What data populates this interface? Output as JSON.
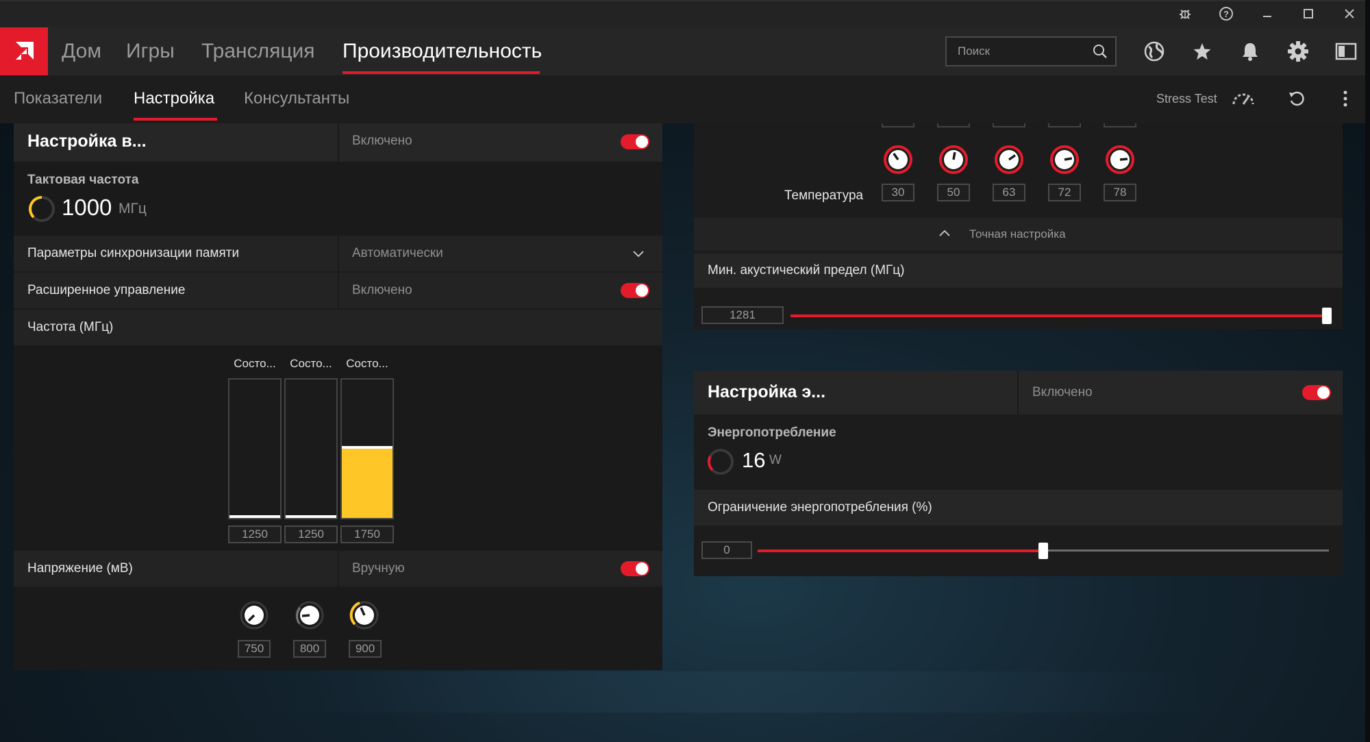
{
  "window": {
    "controls": [
      "bug-icon",
      "help-icon",
      "minimize-icon",
      "maximize-icon",
      "close-icon"
    ]
  },
  "nav": {
    "tabs": [
      {
        "label": "Дом"
      },
      {
        "label": "Игры"
      },
      {
        "label": "Трансляция"
      },
      {
        "label": "Производительность",
        "active": true
      }
    ],
    "search_placeholder": "Поиск",
    "icons": [
      "globe-icon",
      "star-icon",
      "bell-icon",
      "gear-icon",
      "sidebar-toggle-icon"
    ]
  },
  "subnav": {
    "tabs": [
      {
        "label": "Показатели"
      },
      {
        "label": "Настройка",
        "active": true
      },
      {
        "label": "Консультанты"
      }
    ],
    "stress_test_label": "Stress Test"
  },
  "gpu_tuning": {
    "title": "Настройка в...",
    "status": "Включено",
    "clock_label": "Тактовая частота",
    "clock_value": "1000",
    "clock_unit": "МГц",
    "memory_timing_label": "Параметры синхронизации памяти",
    "memory_timing_value": "Автоматически",
    "advanced_control_label": "Расширенное управление",
    "advanced_control_value": "Включено",
    "frequency_label": "Частота (МГц)",
    "states": [
      {
        "title": "Состо...",
        "value": "1250",
        "level": 0.0
      },
      {
        "title": "Состо...",
        "value": "1250",
        "level": 0.0
      },
      {
        "title": "Состо...",
        "value": "1750",
        "level": 0.5
      }
    ],
    "voltage_label": "Напряжение (мВ)",
    "voltage_mode": "Вручную",
    "voltages": [
      "750",
      "800",
      "900"
    ]
  },
  "fan_tuning": {
    "temperature_label": "Температура",
    "temperatures": [
      "30",
      "50",
      "63",
      "72",
      "78"
    ],
    "fine_tuning_label": "Точная настройка",
    "acoustic_limit_label": "Мин. акустический предел (МГц)",
    "acoustic_limit_value": "1281",
    "acoustic_limit_fraction": 1.0
  },
  "power_tuning": {
    "title": "Настройка э...",
    "status": "Включено",
    "power_label": "Энергопотребление",
    "power_value": "16",
    "power_unit": "W",
    "power_limit_label": "Ограничение энергопотребления (%)",
    "power_limit_value": "0",
    "power_limit_fraction": 0.5
  },
  "colors": {
    "accent": "#e41b2b",
    "highlight": "#ffc627"
  }
}
